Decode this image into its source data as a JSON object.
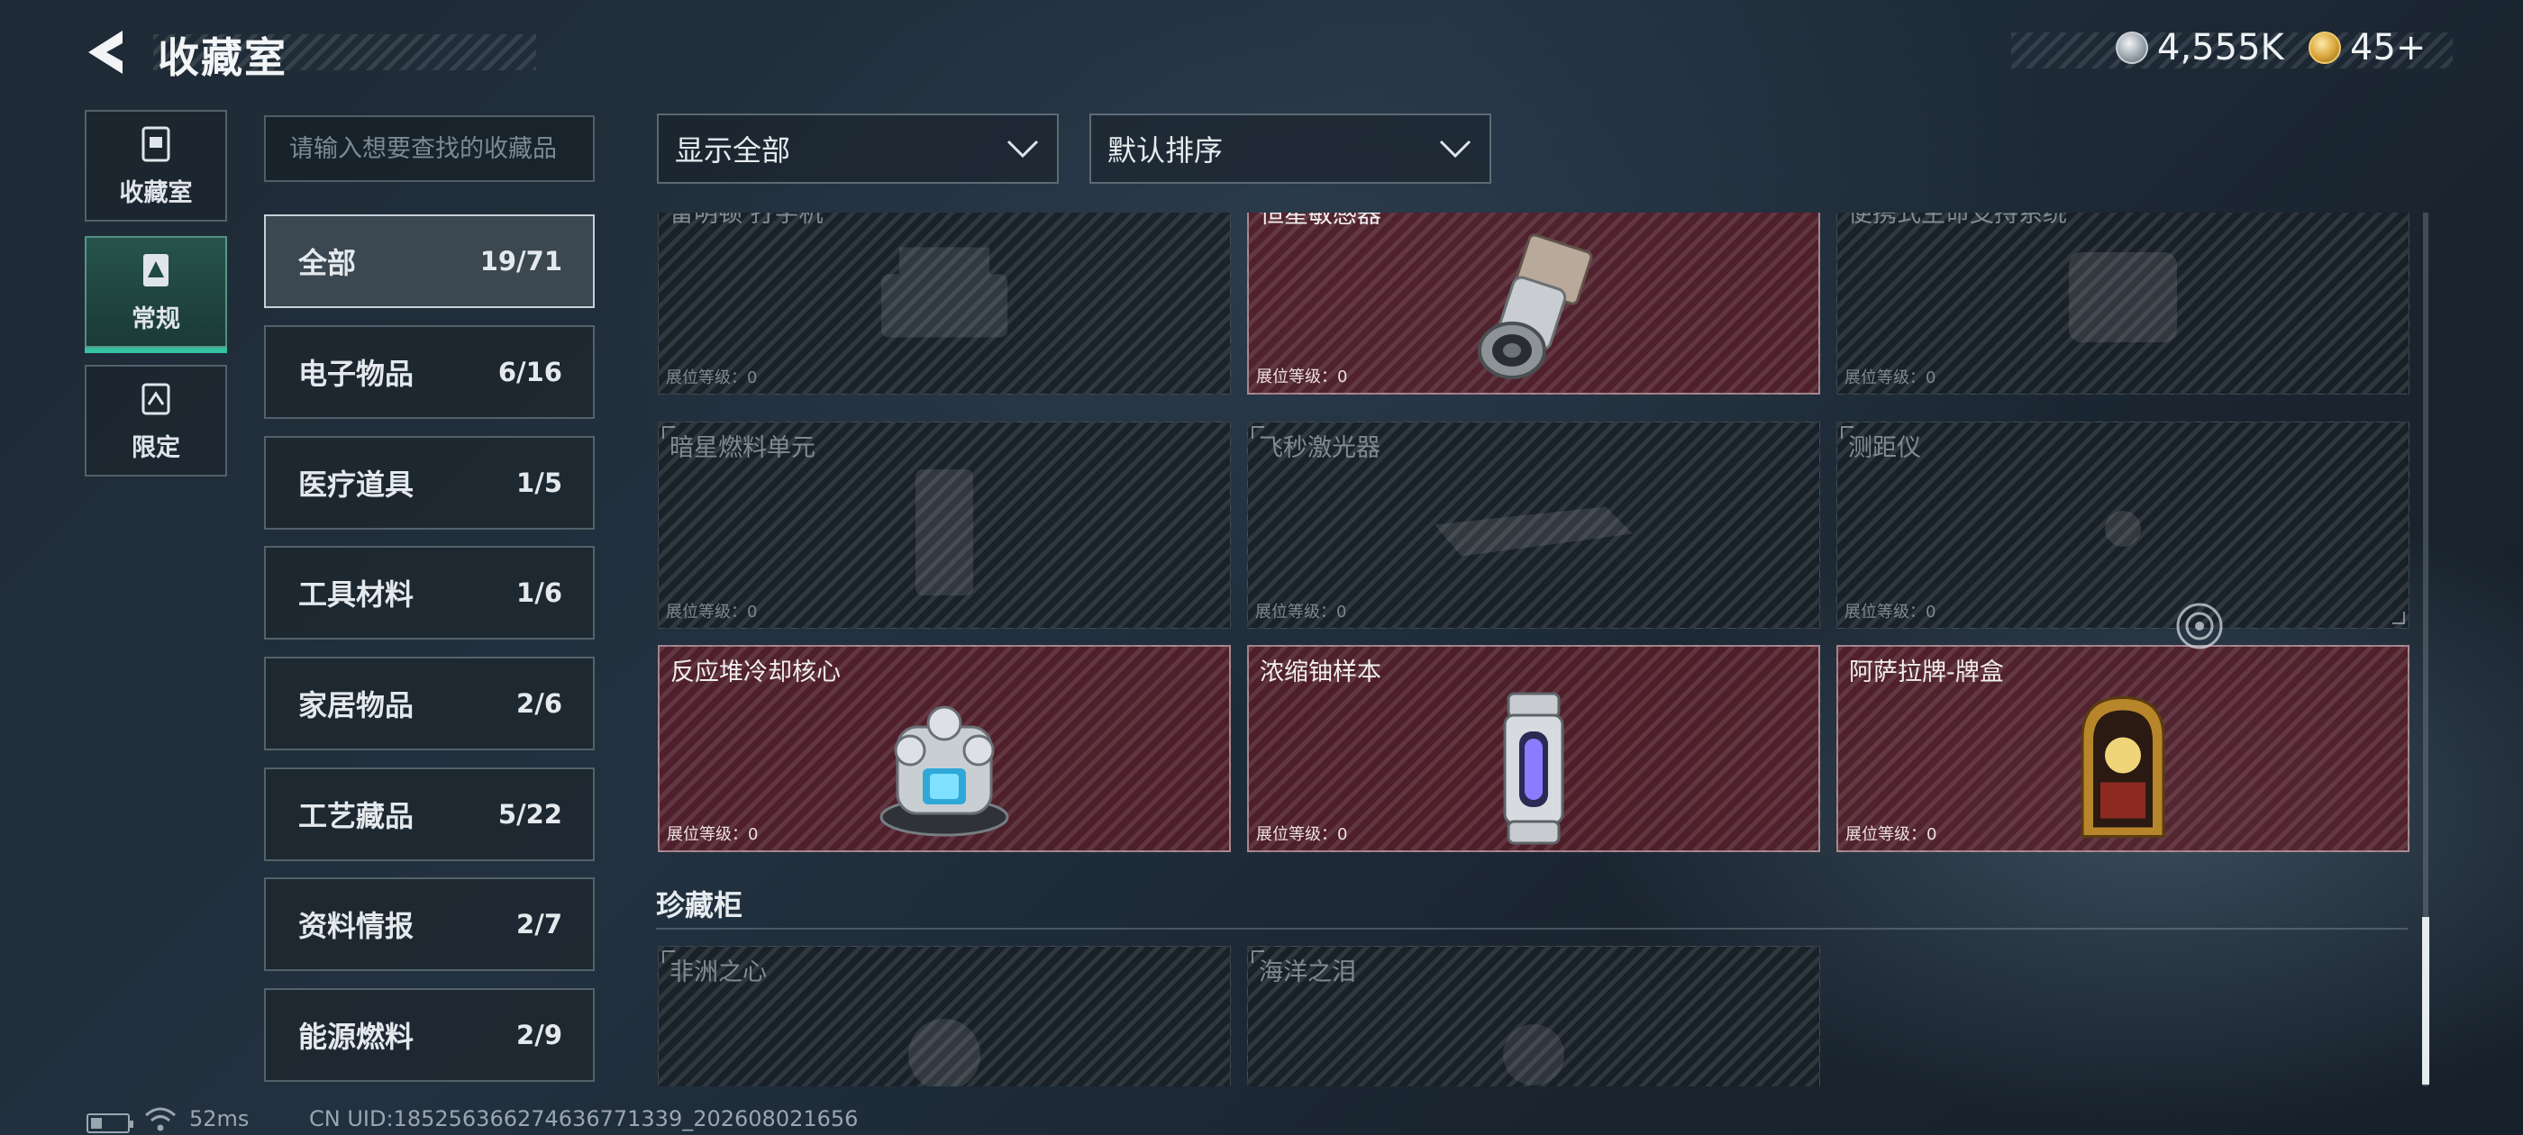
{
  "header": {
    "title": "收藏室",
    "currencies": [
      {
        "icon": "silver-coin-icon",
        "value": "4,555K"
      },
      {
        "icon": "gold-coin-icon",
        "value": "45+"
      }
    ]
  },
  "nav": [
    {
      "icon": "collection-room-icon",
      "label": "收藏室",
      "active": false
    },
    {
      "icon": "regular-icon",
      "label": "常规",
      "active": true
    },
    {
      "icon": "limited-icon",
      "label": "限定",
      "active": false
    }
  ],
  "search": {
    "placeholder": "请输入想要查找的收藏品",
    "value": ""
  },
  "categories": [
    {
      "name": "全部",
      "count": "19/71",
      "active": true
    },
    {
      "name": "电子物品",
      "count": "6/16"
    },
    {
      "name": "医疗道具",
      "count": "1/5"
    },
    {
      "name": "工具材料",
      "count": "1/6"
    },
    {
      "name": "家居物品",
      "count": "2/6"
    },
    {
      "name": "工艺藏品",
      "count": "5/22"
    },
    {
      "name": "资料情报",
      "count": "2/7"
    },
    {
      "name": "能源燃料",
      "count": "2/9"
    }
  ],
  "filters": {
    "show": "显示全部",
    "sort": "默认排序"
  },
  "items": [
    {
      "name": "雷明顿 打字机",
      "level": "展位等级：0",
      "owned": false
    },
    {
      "name": "恒星敏感器",
      "level": "展位等级：0",
      "owned": true
    },
    {
      "name": "便携式生命支持系统",
      "level": "展位等级：0",
      "owned": false
    },
    {
      "name": "暗星燃料单元",
      "level": "展位等级：0",
      "owned": false
    },
    {
      "name": "飞秒激光器",
      "level": "展位等级：0",
      "owned": false
    },
    {
      "name": "测距仪",
      "level": "展位等级：0",
      "owned": false
    },
    {
      "name": "反应堆冷却核心",
      "level": "展位等级：0",
      "owned": true
    },
    {
      "name": "浓缩铀样本",
      "level": "展位等级：0",
      "owned": true
    },
    {
      "name": "阿萨拉牌-牌盒",
      "level": "展位等级：0",
      "owned": true
    }
  ],
  "cabinet": {
    "title": "珍藏柜",
    "items": [
      {
        "name": "非洲之心",
        "owned": false
      },
      {
        "name": "海洋之泪",
        "owned": false
      }
    ]
  },
  "footer": {
    "ping": "52ms",
    "uid": "CN UID:1852563662746367713​39_202608021656"
  },
  "colors": {
    "owned_card": "#5c1c26",
    "locked_card": "#18202a",
    "accent": "#35c2a0"
  }
}
